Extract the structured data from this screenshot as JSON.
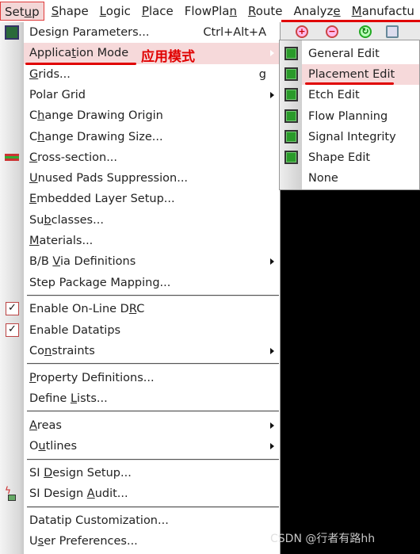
{
  "menubar": {
    "items": [
      {
        "label": "Setup",
        "mn": 3
      },
      {
        "label": "Shape",
        "mn": 0
      },
      {
        "label": "Logic",
        "mn": 0
      },
      {
        "label": "Place",
        "mn": 0
      },
      {
        "label": "FlowPlan",
        "mn": 7
      },
      {
        "label": "Route",
        "mn": 0
      },
      {
        "label": "Analyze",
        "mn": 6
      },
      {
        "label": "Manufactu",
        "mn": 0
      }
    ]
  },
  "menu": {
    "items": [
      {
        "label": "Design Parameters...",
        "shortcut": "Ctrl+Alt+A",
        "icon": "design-parameters-icon"
      },
      {
        "label": "Application Mode",
        "mn": 7,
        "submenu": true,
        "highlighted": true
      },
      {
        "label": "Grids...",
        "mn": 0,
        "shortcut": "g"
      },
      {
        "label": "Polar Grid",
        "submenu": true
      },
      {
        "label": "Change Drawing Origin",
        "mn": 1
      },
      {
        "label": "Change Drawing Size...",
        "mn": 1
      },
      {
        "label": "Cross-section...",
        "mn": 0,
        "icon": "cross-section-icon"
      },
      {
        "label": "Unused Pads Suppression...",
        "mn": 0
      },
      {
        "label": "Embedded Layer Setup...",
        "mn": 0
      },
      {
        "label": "Subclasses...",
        "mn": 2
      },
      {
        "label": "Materials...",
        "mn": 0
      },
      {
        "label": "B/B Via Definitions",
        "mn": 4,
        "submenu": true
      },
      {
        "label": "Step Package Mapping..."
      },
      {
        "sep": true
      },
      {
        "label": "Enable On-Line DRC",
        "mn": 16,
        "checked": true
      },
      {
        "label": "Enable Datatips",
        "checked": true
      },
      {
        "label": "Constraints",
        "mn": 2,
        "submenu": true
      },
      {
        "sep": true
      },
      {
        "label": "Property Definitions...",
        "mn": 0
      },
      {
        "label": "Define Lists...",
        "mn": 7
      },
      {
        "sep": true
      },
      {
        "label": "Areas",
        "mn": 0,
        "submenu": true
      },
      {
        "label": "Outlines",
        "mn": 1,
        "submenu": true
      },
      {
        "sep": true
      },
      {
        "label": "SI Design Setup...",
        "mn": 3
      },
      {
        "label": "SI Design Audit...",
        "mn": 10,
        "icon": "si-audit-icon"
      },
      {
        "sep": true
      },
      {
        "label": "Datatip Customization..."
      },
      {
        "label": "User Preferences...",
        "mn": 1
      }
    ]
  },
  "submenu": {
    "items": [
      {
        "label": "General Edit",
        "icon": "general-edit-icon"
      },
      {
        "label": "Placement Edit",
        "icon": "placement-edit-icon",
        "highlighted": true
      },
      {
        "label": "Etch Edit",
        "icon": "etch-edit-icon"
      },
      {
        "label": "Flow Planning",
        "icon": "flow-planning-icon"
      },
      {
        "label": "Signal Integrity",
        "icon": "signal-integrity-icon"
      },
      {
        "label": "Shape Edit",
        "icon": "shape-edit-icon"
      },
      {
        "label": "None"
      }
    ]
  },
  "annotation": {
    "text": "应用模式",
    "color": "#e00000"
  },
  "watermark": "CSDN @行者有路hh",
  "colors": {
    "highlight": "#f6d9da",
    "annotation": "#e00000"
  }
}
